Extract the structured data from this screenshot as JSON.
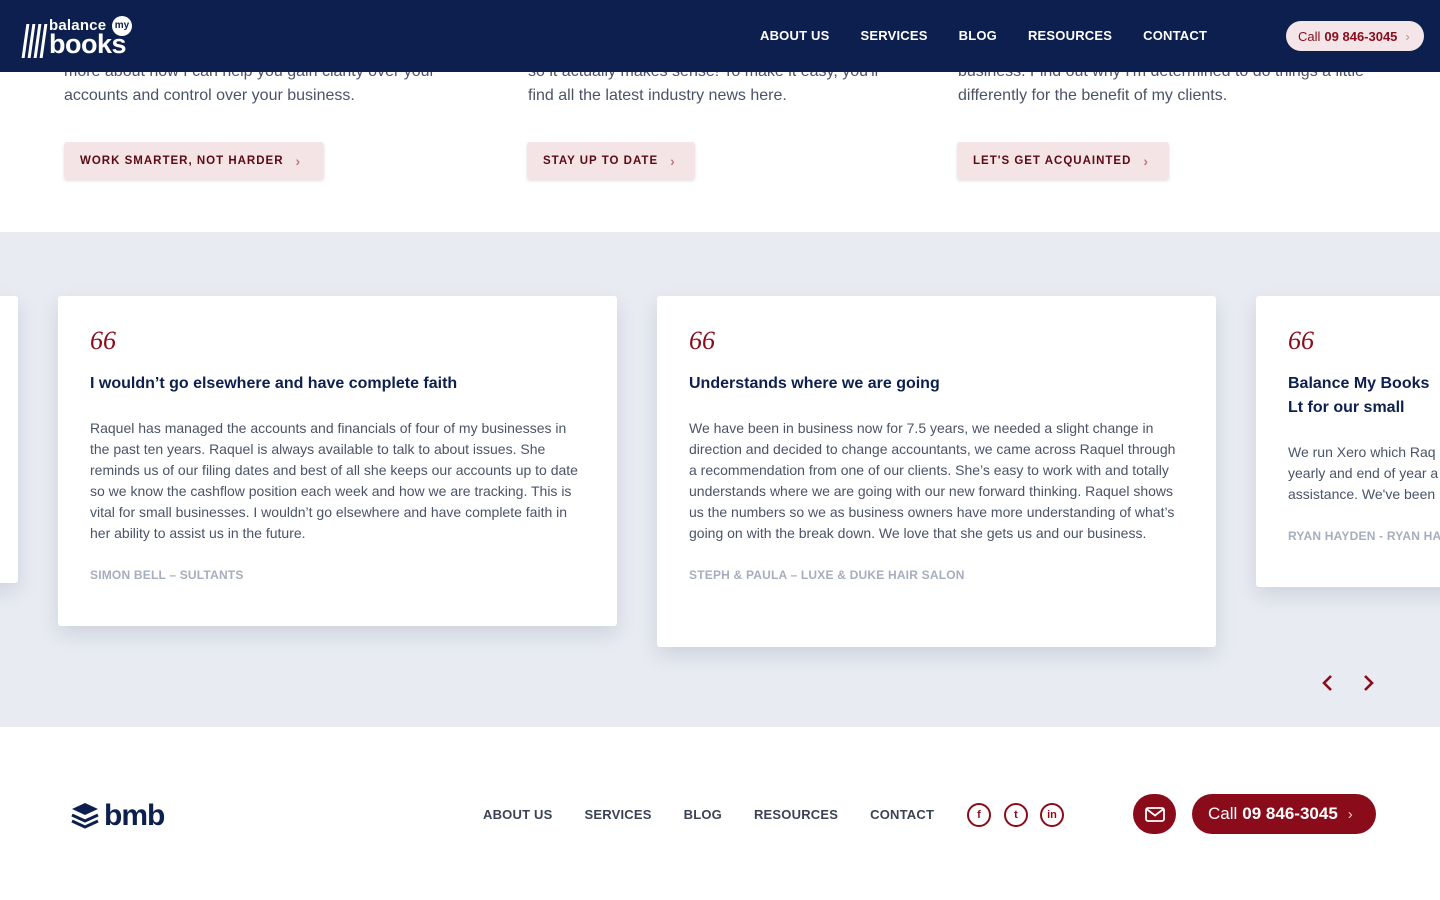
{
  "header": {
    "logo_top": "balance",
    "logo_my": "my",
    "logo_bottom": "books",
    "nav": [
      "ABOUT US",
      "SERVICES",
      "BLOG",
      "RESOURCES",
      "CONTACT"
    ],
    "call_prefix": "Call",
    "call_number": "09 846-3045"
  },
  "top_columns": [
    {
      "text": "more about how I can help you gain clarity over your accounts and control over your business.",
      "cta": "WORK SMARTER, NOT HARDER"
    },
    {
      "text": "so it actually makes sense! To make it easy, you'll find all the latest industry news here.",
      "cta": "STAY UP TO DATE"
    },
    {
      "text": "business. Find out why I'm determined to do things a little differently for the benefit of my clients.",
      "cta": "LET'S GET ACQUAINTED"
    }
  ],
  "testimonials": [
    {
      "quote_mark": "66",
      "title": "I wouldn’t go elsewhere and have complete faith",
      "body": "Raquel has managed the accounts and financials of four of my businesses in the past ten years. Raquel is always available to talk to about issues. She reminds us of our filing dates and best of all she keeps our accounts up to date so we know the cashflow position each week and how we are tracking. This is vital for small businesses. I wouldn’t go elsewhere and have complete faith in her ability to assist us in the future.",
      "author": "SIMON BELL – SULTANTS"
    },
    {
      "quote_mark": "66",
      "title": "Understands where we are going",
      "body": "We have been in business now for 7.5 years, we needed a slight change in direction and decided to change accountants, we came across Raquel through a recommendation from one of our clients. She’s easy to work with and totally understands where we are going with our new forward thinking. Raquel shows us the numbers so we as business owners have more understanding of what’s going on with the break down. We love that she gets us and our business.",
      "author": "STEPH & PAULA – LUXE & DUKE HAIR SALON"
    },
    {
      "quote_mark": "66",
      "title": "Balance My Books Lt for our small busine",
      "body": "We run Xero which Raq yearly and end of year a assistance. We've been",
      "author": "RYAN HAYDEN - RYAN HA"
    }
  ],
  "slider": {
    "prev_icon": "chevron-left-icon",
    "next_icon": "chevron-right-icon"
  },
  "footer": {
    "logo": "bmb",
    "nav": [
      "ABOUT US",
      "SERVICES",
      "BLOG",
      "RESOURCES",
      "CONTACT"
    ],
    "social": [
      {
        "icon": "facebook-icon",
        "glyph": "f"
      },
      {
        "icon": "twitter-icon",
        "glyph": "t"
      },
      {
        "icon": "linkedin-icon",
        "glyph": "in"
      }
    ],
    "call_prefix": "Call",
    "call_number": "09 846-3045"
  },
  "colors": {
    "navy": "#0c1f4e",
    "maroon": "#8a0c1a",
    "pink": "#f4e4e5",
    "band": "#e8ebf2"
  }
}
